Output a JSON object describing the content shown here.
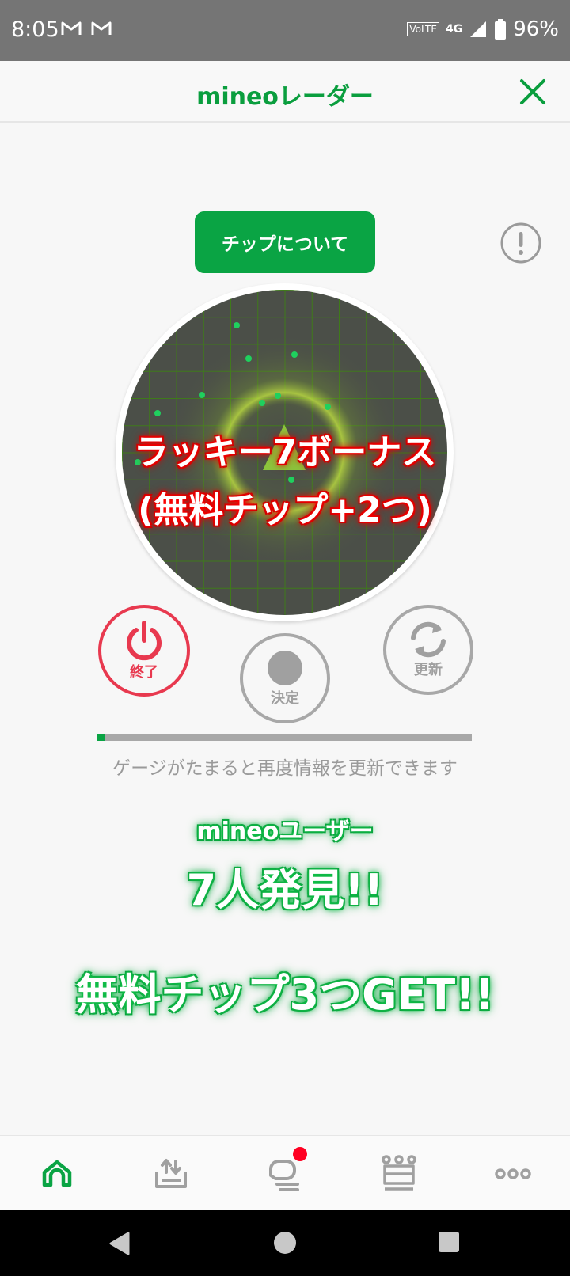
{
  "status_bar": {
    "time": "8:05",
    "volte": "VoLTE",
    "network": "4G",
    "battery": "96%"
  },
  "header": {
    "title": "mineoレーダー"
  },
  "chip_button": {
    "label": "チップについて"
  },
  "radar": {
    "bonus_line1": "ラッキー7ボーナス",
    "bonus_line2": "(無料チップ+2つ)"
  },
  "controls": {
    "end_label": "終了",
    "decide_label": "決定",
    "refresh_label": "更新"
  },
  "gauge": {
    "progress": 0.02,
    "text": "ゲージがたまると再度情報を更新できます"
  },
  "result": {
    "users_label": "mineoユーザー",
    "found": "7人発見!!",
    "get": "無料チップ3つGET!!"
  },
  "bottom_nav": {
    "items": [
      "home-icon",
      "upload-icon",
      "chat-icon",
      "crown-icon",
      "more-icon"
    ],
    "has_notification": true
  },
  "colors": {
    "brand_green": "#0aa444",
    "end_red": "#e8394f",
    "notification_red": "#ff0022"
  }
}
